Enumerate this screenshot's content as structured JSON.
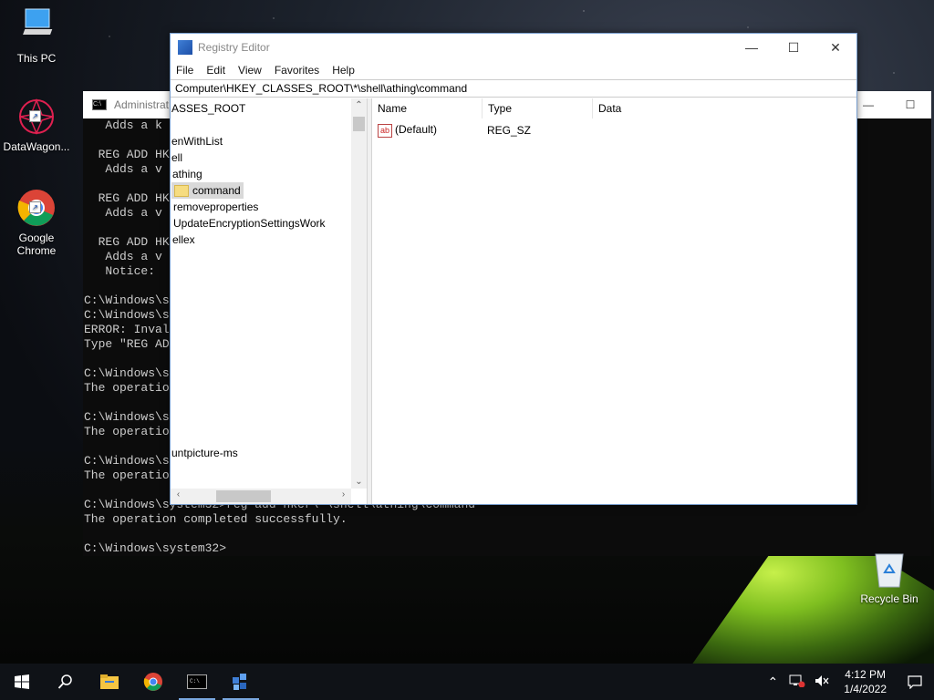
{
  "desktop": {
    "icons": [
      {
        "label": "This PC"
      },
      {
        "label": "DataWagon..."
      },
      {
        "label": "Google\nChrome"
      }
    ],
    "recycle_bin": {
      "label": "Recycle Bin"
    }
  },
  "cmd_window": {
    "title": "Administrat",
    "lines": [
      "   Adds a k",
      "",
      "  REG ADD HK",
      "   Adds a v",
      "",
      "  REG ADD HK",
      "   Adds a v",
      "",
      "  REG ADD HK",
      "   Adds a v",
      "   Notice: ",
      "",
      "C:\\Windows\\s",
      "C:\\Windows\\s",
      "ERROR: Inval",
      "Type \"REG AD",
      "",
      "C:\\Windows\\s",
      "The operatio",
      "",
      "C:\\Windows\\s",
      "The operatio",
      "",
      "C:\\Windows\\s",
      "The operatio",
      "",
      "C:\\Windows\\system32>reg add hkcr\\*\\shell\\athing\\command",
      "The operation completed successfully.",
      "",
      "C:\\Windows\\system32>"
    ]
  },
  "regedit": {
    "title": "Registry Editor",
    "menu": [
      "File",
      "Edit",
      "View",
      "Favorites",
      "Help"
    ],
    "address": "Computer\\HKEY_CLASSES_ROOT\\*\\shell\\athing\\command",
    "tree": {
      "root_label": "ASSES_ROOT",
      "items": [
        {
          "label": "enWithList"
        },
        {
          "label": "ell"
        },
        {
          "label": "athing"
        },
        {
          "label": "command"
        },
        {
          "label": "removeproperties"
        },
        {
          "label": "UpdateEncryptionSettingsWork"
        },
        {
          "label": "ellex"
        },
        {
          "label": "untpicture-ms"
        }
      ]
    },
    "columns": [
      "Name",
      "Type",
      "Data"
    ],
    "values": [
      {
        "name": "(Default)",
        "type": "REG_SZ",
        "data": "",
        "icon": "ab"
      }
    ]
  },
  "taskbar": {
    "time": "4:12 PM",
    "date": "1/4/2022",
    "apps": [
      "start-icon",
      "search-icon",
      "file-explorer-icon",
      "chrome-icon",
      "cmd-icon",
      "regedit-icon"
    ]
  }
}
